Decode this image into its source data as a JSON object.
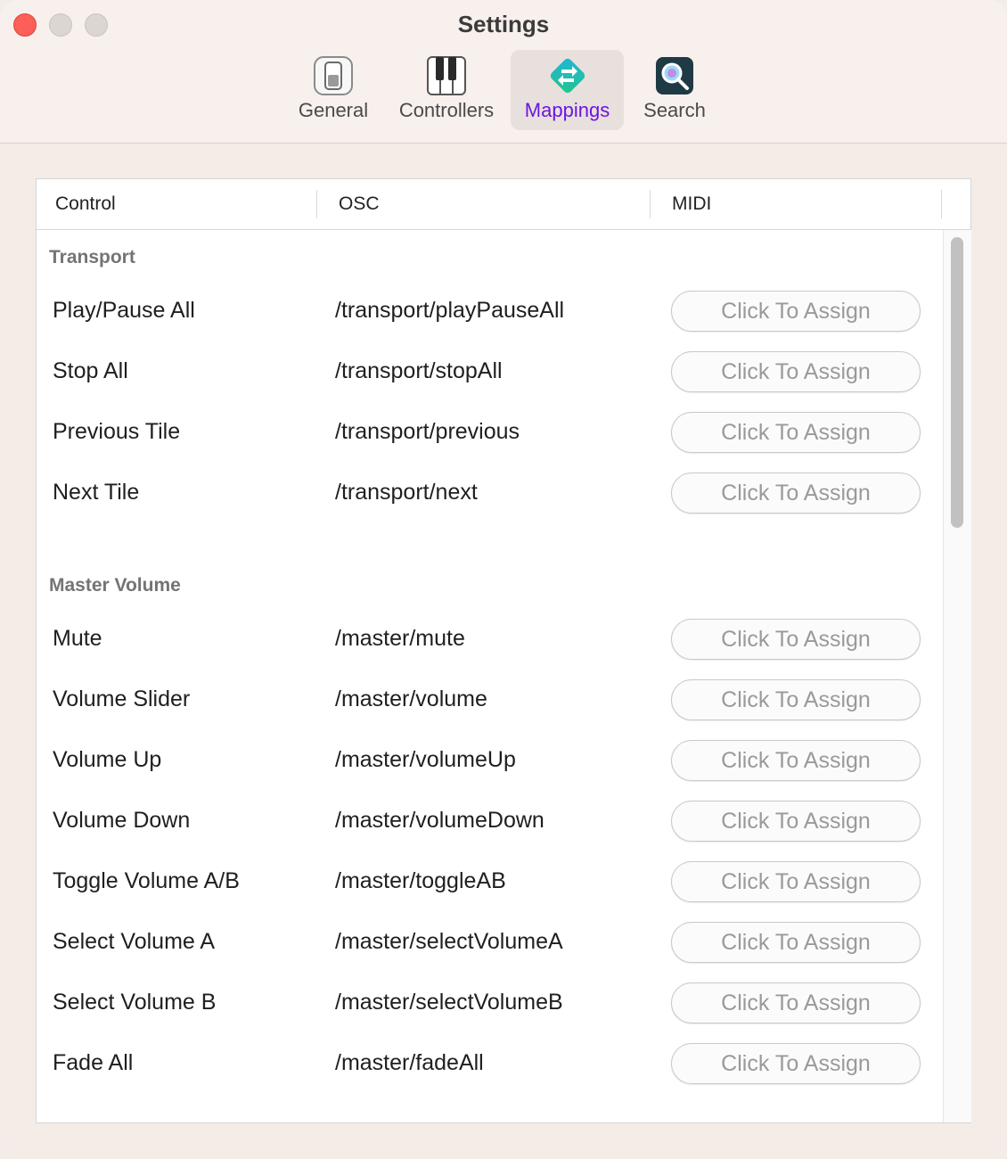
{
  "window": {
    "title": "Settings"
  },
  "tabs": [
    {
      "label": "General",
      "icon": "toggle-switch-icon"
    },
    {
      "label": "Controllers",
      "icon": "piano-keys-icon"
    },
    {
      "label": "Mappings",
      "icon": "mappings-arrows-icon",
      "active": true
    },
    {
      "label": "Search",
      "icon": "magnifier-icon"
    }
  ],
  "columns": {
    "control": "Control",
    "osc": "OSC",
    "midi": "MIDI"
  },
  "sections": [
    {
      "title": "Transport",
      "rows": [
        {
          "control": "Play/Pause All",
          "osc": "/transport/playPauseAll",
          "midi": "Click To Assign"
        },
        {
          "control": "Stop All",
          "osc": "/transport/stopAll",
          "midi": "Click To Assign"
        },
        {
          "control": "Previous Tile",
          "osc": "/transport/previous",
          "midi": "Click To Assign"
        },
        {
          "control": "Next Tile",
          "osc": "/transport/next",
          "midi": "Click To Assign"
        }
      ]
    },
    {
      "title": "Master Volume",
      "rows": [
        {
          "control": "Mute",
          "osc": "/master/mute",
          "midi": "Click To Assign"
        },
        {
          "control": "Volume Slider",
          "osc": "/master/volume",
          "midi": "Click To Assign"
        },
        {
          "control": "Volume Up",
          "osc": "/master/volumeUp",
          "midi": "Click To Assign"
        },
        {
          "control": "Volume Down",
          "osc": "/master/volumeDown",
          "midi": "Click To Assign"
        },
        {
          "control": "Toggle Volume A/B",
          "osc": "/master/toggleAB",
          "midi": "Click To Assign"
        },
        {
          "control": "Select Volume A",
          "osc": "/master/selectVolumeA",
          "midi": "Click To Assign"
        },
        {
          "control": "Select Volume B",
          "osc": "/master/selectVolumeB",
          "midi": "Click To Assign"
        },
        {
          "control": "Fade All",
          "osc": "/master/fadeAll",
          "midi": "Click To Assign"
        }
      ]
    }
  ],
  "colors": {
    "accent": "#6b16e0",
    "close": "#fc5f57"
  }
}
